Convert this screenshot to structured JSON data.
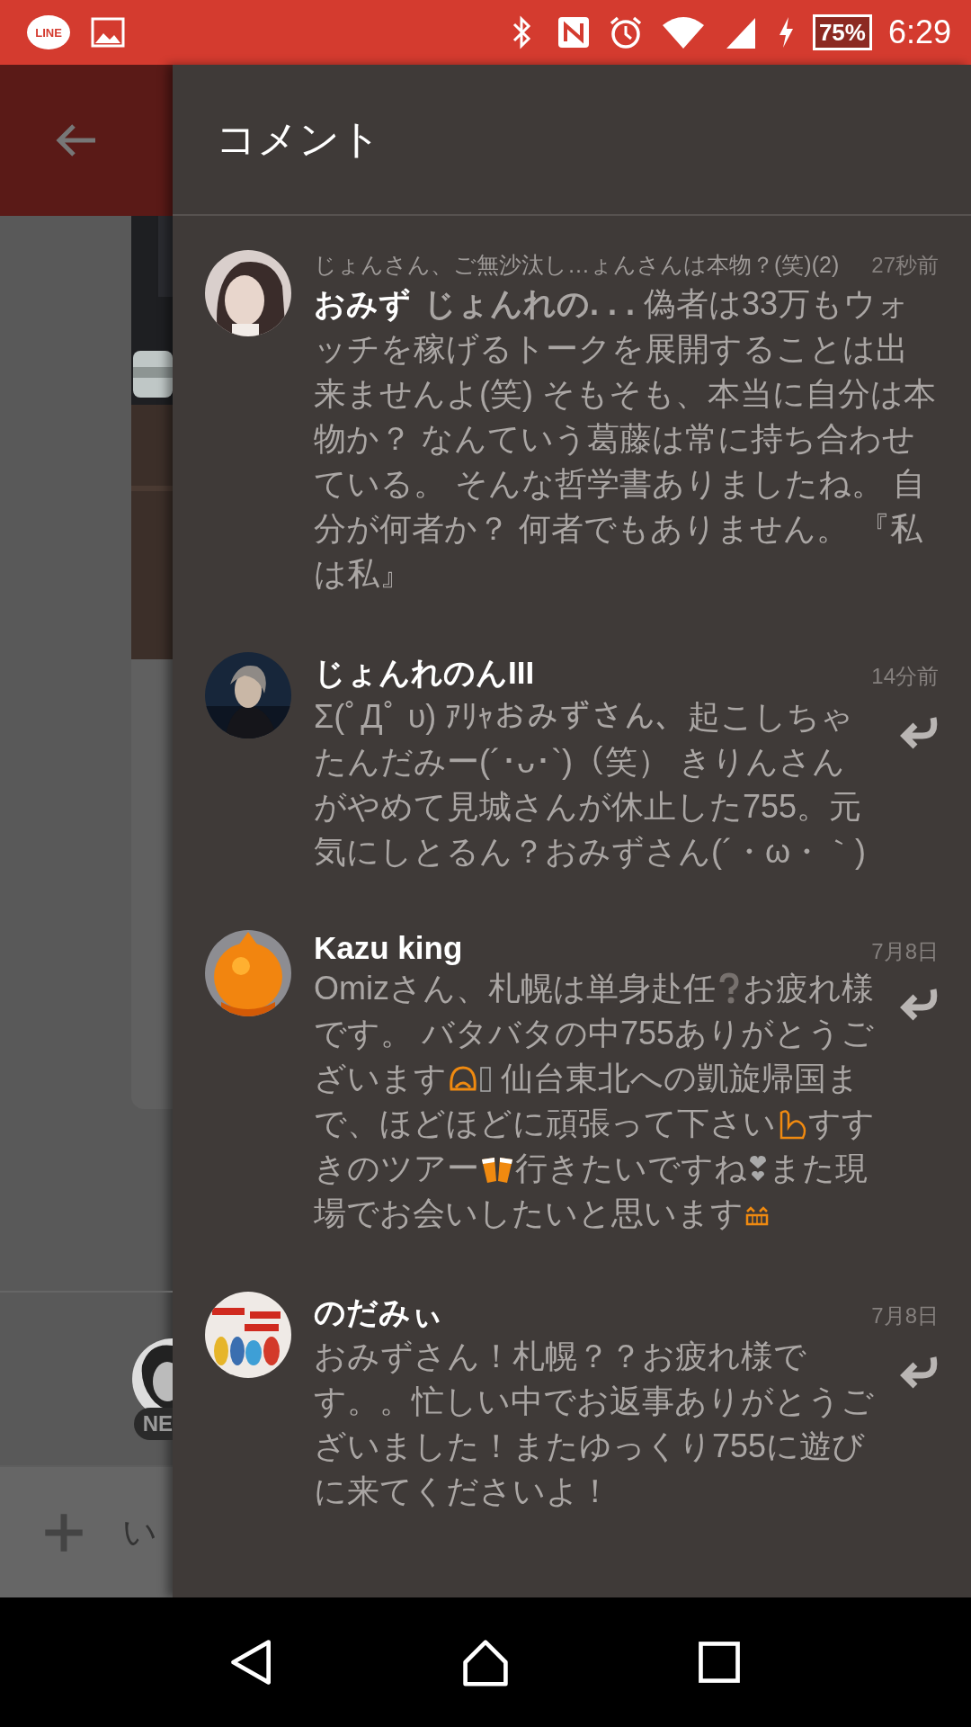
{
  "status_bar": {
    "app_badge": "LINE",
    "battery": "75%",
    "time": "6:29"
  },
  "background_page": {
    "badge": "NE",
    "input_placeholder": "い"
  },
  "drawer": {
    "title": "コメント"
  },
  "comments": [
    {
      "author": "おみず",
      "quote": "じょんさん、ご無沙汰し…ょんさんは本物？(笑)(2)",
      "time": "27秒前",
      "reply": false,
      "body": [
        {
          "kind": "text",
          "text": "**じょんれの. . .**  偽者は33万もウォッチを稼げるトークを展開することは出来ませんよ(笑)  そもそも、本当に自分は本物か？ なんていう葛藤は常に持ち合わせている。 そんな哲学書ありましたね。  自分が何者か？ 何者でもありません。 『私は私』"
        }
      ]
    },
    {
      "author": "じょんれのんIII",
      "time": "14分前",
      "reply": true,
      "body": [
        {
          "kind": "text",
          "text": "Σ(ﾟДﾟ υ) ｱﾘｬおみずさん、起こしちゃたんだみー(´･ᴗ･`)（笑） きりんさんがやめて見城さんが休止した755。元気にしとるん？おみずさん(´・ω・｀)"
        }
      ]
    },
    {
      "author": "Kazu king",
      "time": "7月8日",
      "reply": true,
      "body": [
        {
          "kind": "text",
          "text": "Omizさん、札幌は単身赴任"
        },
        {
          "kind": "emoji"
        },
        {
          "kind": "text",
          "text": "お疲れ様です。 バタバタの中755ありがとうございます"
        },
        {
          "kind": "emoji"
        },
        {
          "kind": "emoji"
        },
        {
          "kind": "text",
          "text": " 仙台東北への凱旋帰国まで、ほどほどに頑張って下さい"
        },
        {
          "kind": "emoji"
        },
        {
          "kind": "text",
          "text": "すすきのツアー"
        },
        {
          "kind": "emoji"
        },
        {
          "kind": "text",
          "text": "行きたいですね"
        },
        {
          "kind": "emoji"
        },
        {
          "kind": "text",
          "text": "また現場でお会いしたいと思います"
        },
        {
          "kind": "emoji"
        }
      ]
    },
    {
      "author": "のだみぃ",
      "time": "7月8日",
      "reply": true,
      "body": [
        {
          "kind": "text",
          "text": "おみずさん！札幌？？お疲れ様です。。忙しい中でお返事ありがとうございました！またゆっくり755に遊びに来てくださいよ！"
        }
      ]
    }
  ]
}
